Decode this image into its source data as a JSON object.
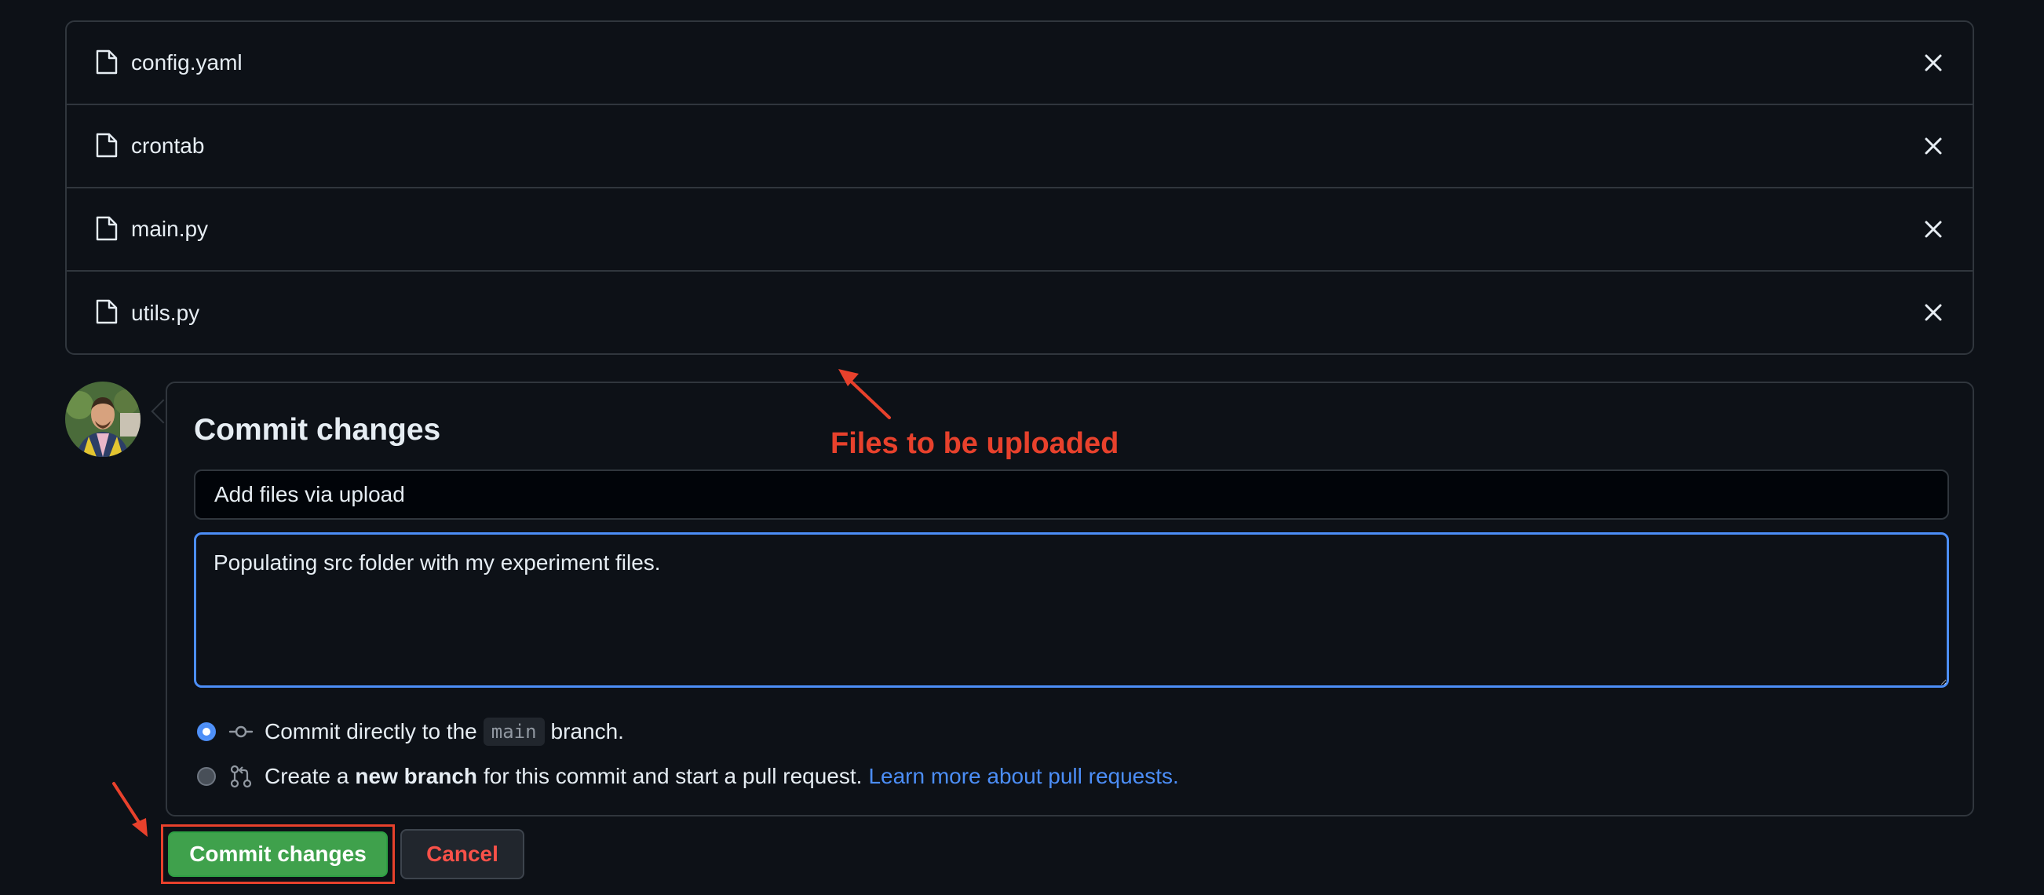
{
  "files": [
    {
      "name": "config.yaml"
    },
    {
      "name": "crontab"
    },
    {
      "name": "main.py"
    },
    {
      "name": "utils.py"
    }
  ],
  "commit": {
    "title": "Commit changes",
    "summary_value": "Add files via upload",
    "description_value": "Populating src folder with my experiment files.",
    "option_direct": {
      "prefix": "Commit directly to the",
      "branch": "main",
      "suffix": "branch."
    },
    "option_new_branch": {
      "prefix": "Create a",
      "bold": "new branch",
      "suffix": "for this commit and start a pull request.",
      "link": "Learn more about pull requests."
    }
  },
  "buttons": {
    "commit_label": "Commit changes",
    "cancel_label": "Cancel"
  },
  "annotation": {
    "text": "Files to be uploaded"
  },
  "colors": {
    "background": "#0d1117",
    "border": "#30363d",
    "accent_blue": "#4c8ef7",
    "commit_green": "#3fa14c",
    "cancel_red": "#f85149",
    "annotation_red": "#e8412c"
  },
  "icons": {
    "file": "file-icon",
    "remove": "close-icon",
    "commit": "git-commit-icon",
    "pull_request": "git-pull-request-icon"
  }
}
